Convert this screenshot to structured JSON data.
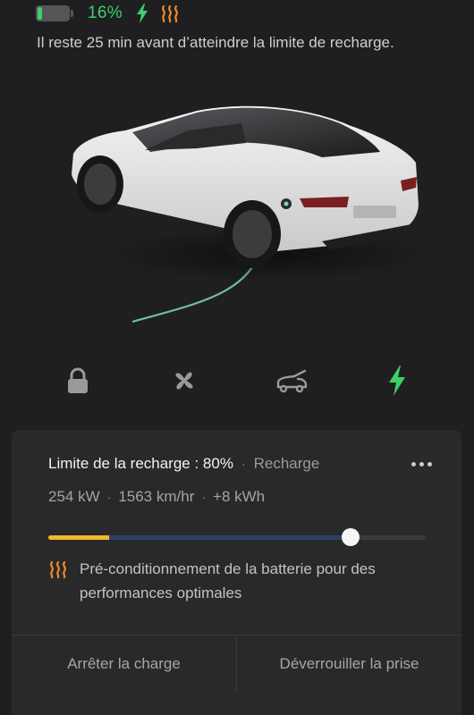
{
  "status": {
    "battery_percent_text": "16%",
    "battery_level": 0.16,
    "accent_green": "#3ecf6a",
    "accent_orange": "#f08a24",
    "icons": [
      "battery-icon",
      "charging-bolt-icon",
      "battery-heating-icon"
    ]
  },
  "message": "Il reste 25 min avant d’atteindre la limite de recharge.",
  "quick_controls": [
    {
      "name": "lock",
      "icon": "lock-icon"
    },
    {
      "name": "climate",
      "icon": "fan-icon"
    },
    {
      "name": "trunk",
      "icon": "trunk-icon"
    },
    {
      "name": "charging",
      "icon": "charging-bolt-icon",
      "active": true
    }
  ],
  "charge_panel": {
    "limit_label": "Limite de la recharge : 80%",
    "limit_value_percent": 80,
    "state_label": "Recharge",
    "stats": [
      "254 kW",
      "1563 km/hr",
      "+8 kWh"
    ],
    "current_level_percent": 16,
    "preconditioning_text": "Pré-conditionnement de la batterie pour des performances optimales",
    "colors": {
      "current_charge": "#f0b92c",
      "pending_charge": "#2d3f6b"
    }
  },
  "actions": {
    "stop_label": "Arrêter la charge",
    "unlock_label": "Déverrouiller la prise"
  }
}
